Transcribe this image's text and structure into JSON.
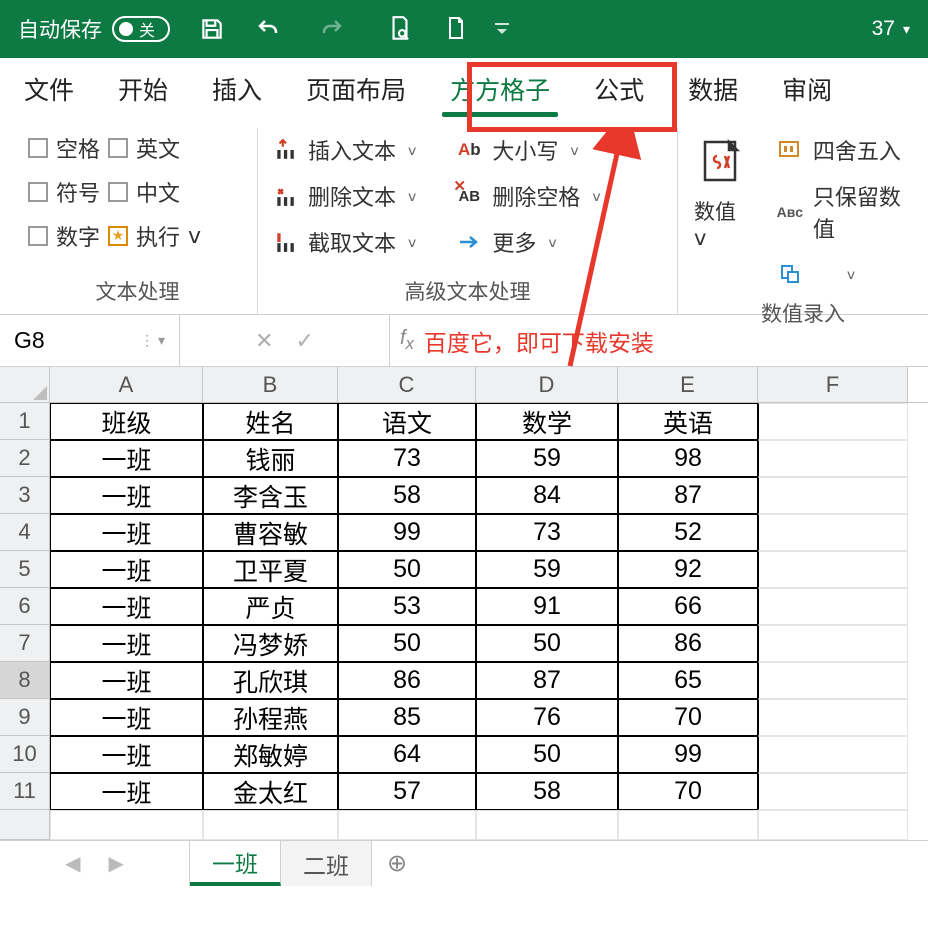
{
  "titlebar": {
    "autosave_label": "自动保存",
    "autosave_state": "关",
    "qa_count": "37"
  },
  "tabs": {
    "file": "文件",
    "home": "开始",
    "insert": "插入",
    "layout": "页面布局",
    "ffgz": "方方格子",
    "formula": "公式",
    "data": "数据",
    "review": "审阅"
  },
  "ribbon": {
    "group1_label": "文本处理",
    "chk_space": "空格",
    "chk_en": "英文",
    "chk_symbol": "符号",
    "chk_cn": "中文",
    "chk_num": "数字",
    "chk_exec": "执行",
    "group2_label": "高级文本处理",
    "insert_text": "插入文本",
    "delete_text": "删除文本",
    "cut_text": "截取文本",
    "case": "大小写",
    "del_space": "删除空格",
    "more": "更多",
    "numval": "数值",
    "group3_label": "数值录入",
    "round": "四舍五入",
    "keepnum": "只保留数值"
  },
  "namebox": "G8",
  "annotation": "百度它，即可下载安装",
  "columns": [
    "A",
    "B",
    "C",
    "D",
    "E",
    "F"
  ],
  "rows": [
    "1",
    "2",
    "3",
    "4",
    "5",
    "6",
    "7",
    "8",
    "9",
    "10",
    "11"
  ],
  "headers": [
    "班级",
    "姓名",
    "语文",
    "数学",
    "英语"
  ],
  "data": [
    [
      "一班",
      "钱丽",
      "73",
      "59",
      "98"
    ],
    [
      "一班",
      "李含玉",
      "58",
      "84",
      "87"
    ],
    [
      "一班",
      "曹容敏",
      "99",
      "73",
      "52"
    ],
    [
      "一班",
      "卫平夏",
      "50",
      "59",
      "92"
    ],
    [
      "一班",
      "严贞",
      "53",
      "91",
      "66"
    ],
    [
      "一班",
      "冯梦娇",
      "50",
      "50",
      "86"
    ],
    [
      "一班",
      "孔欣琪",
      "86",
      "87",
      "65"
    ],
    [
      "一班",
      "孙程燕",
      "85",
      "76",
      "70"
    ],
    [
      "一班",
      "郑敏婷",
      "64",
      "50",
      "99"
    ],
    [
      "一班",
      "金太红",
      "57",
      "58",
      "70"
    ]
  ],
  "sheets": {
    "s1": "一班",
    "s2": "二班"
  }
}
